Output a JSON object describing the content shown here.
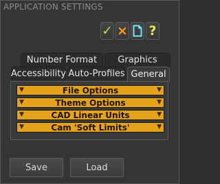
{
  "window": {
    "title": "APPLICATION SETTINGS"
  },
  "toolbar": {
    "accept_glyph": "✓",
    "cancel_glyph": "×",
    "new_glyph": "new-document-icon",
    "help_glyph": "?"
  },
  "tabs": {
    "back_row": [
      {
        "label": "Number Format"
      },
      {
        "label": "Graphics"
      }
    ],
    "front_row": [
      {
        "label": "Accessibility"
      },
      {
        "label": "Auto-Profiles"
      },
      {
        "label": "General"
      }
    ],
    "active": "General"
  },
  "sections": [
    {
      "label": "File Options"
    },
    {
      "label": "Theme Options"
    },
    {
      "label": "CAD Linear Units"
    },
    {
      "label": "Cam 'Soft Limits'"
    }
  ],
  "footer": {
    "save_label": "Save",
    "load_label": "Load"
  },
  "colors": {
    "section_bar": "#e5a21a",
    "accept": "#b6e23c",
    "cancel": "#ff9a1e",
    "help": "#e5e84f",
    "new_doc": "#6fe8ff"
  }
}
